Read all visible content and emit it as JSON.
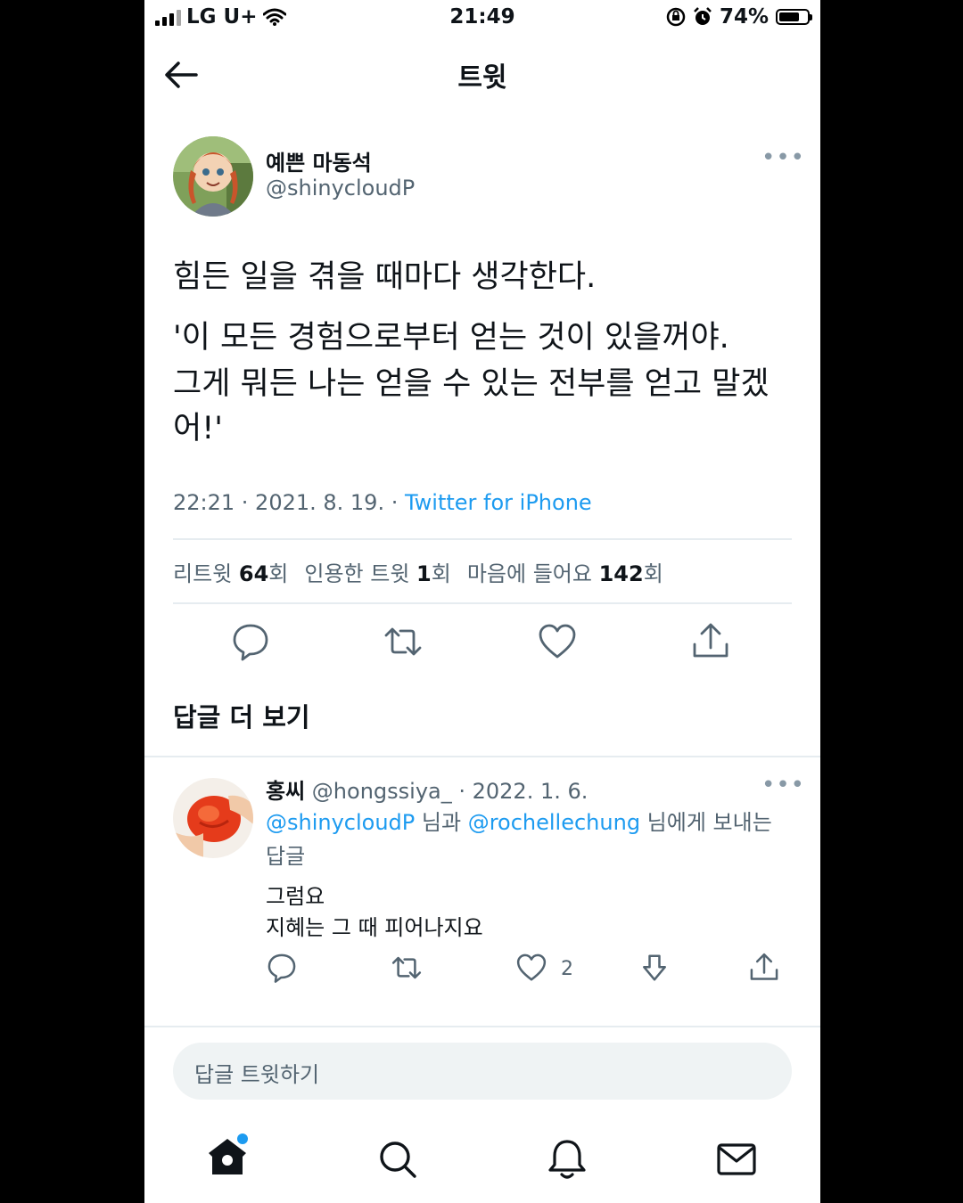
{
  "status_bar": {
    "carrier": "LG U+",
    "time": "21:49",
    "battery_text": "74%",
    "battery_level": 0.74
  },
  "header": {
    "title": "트윗"
  },
  "tweet": {
    "display_name": "예쁜 마동석",
    "handle": "@shinycloudP",
    "text_lines": [
      "힘든 일을 겪을 때마다 생각한다.",
      "'이 모든 경험으로부터 얻는 것이 있을꺼야.",
      "그게 뭐든 나는 얻을 수 있는 전부를 얻고 말겠",
      "어!'"
    ],
    "timestamp": "22:21 · 2021. 8. 19. · ",
    "source": "Twitter for iPhone",
    "stats": {
      "retweets_label": "리트윗 ",
      "retweets_value": "64",
      "retweets_unit": "회",
      "quotes_label": "인용한 트윗 ",
      "quotes_value": "1",
      "quotes_unit": "회",
      "likes_label": "마음에 들어요 ",
      "likes_value": "142",
      "likes_unit": "회"
    }
  },
  "more_replies_title": "답글 더 보기",
  "reply": {
    "display_name": "홍씨",
    "handle_date": " @hongssiya_ · 2022. 1. 6.",
    "mention1": "@shinycloudP",
    "joiner": " 님과 ",
    "mention2": "@rochellechung",
    "suffix": " 님에게 보내는 답글",
    "line1": "그럼요",
    "line2": "지혜는 그 때 피어나지요",
    "like_count": "2"
  },
  "compose_placeholder": "답글 트윗하기",
  "icons": {
    "back": "back-arrow-icon",
    "more": "more-icon",
    "reply": "reply-icon",
    "retweet": "retweet-icon",
    "like": "heart-icon",
    "share": "share-icon",
    "downvote": "downvote-icon",
    "home": "home-icon",
    "search": "search-icon",
    "notifications": "bell-icon",
    "messages": "mail-icon"
  },
  "colors": {
    "accent": "#1d9bf0",
    "text": "#0f1419",
    "secondary": "#536471",
    "divider": "#e6ecf0"
  }
}
